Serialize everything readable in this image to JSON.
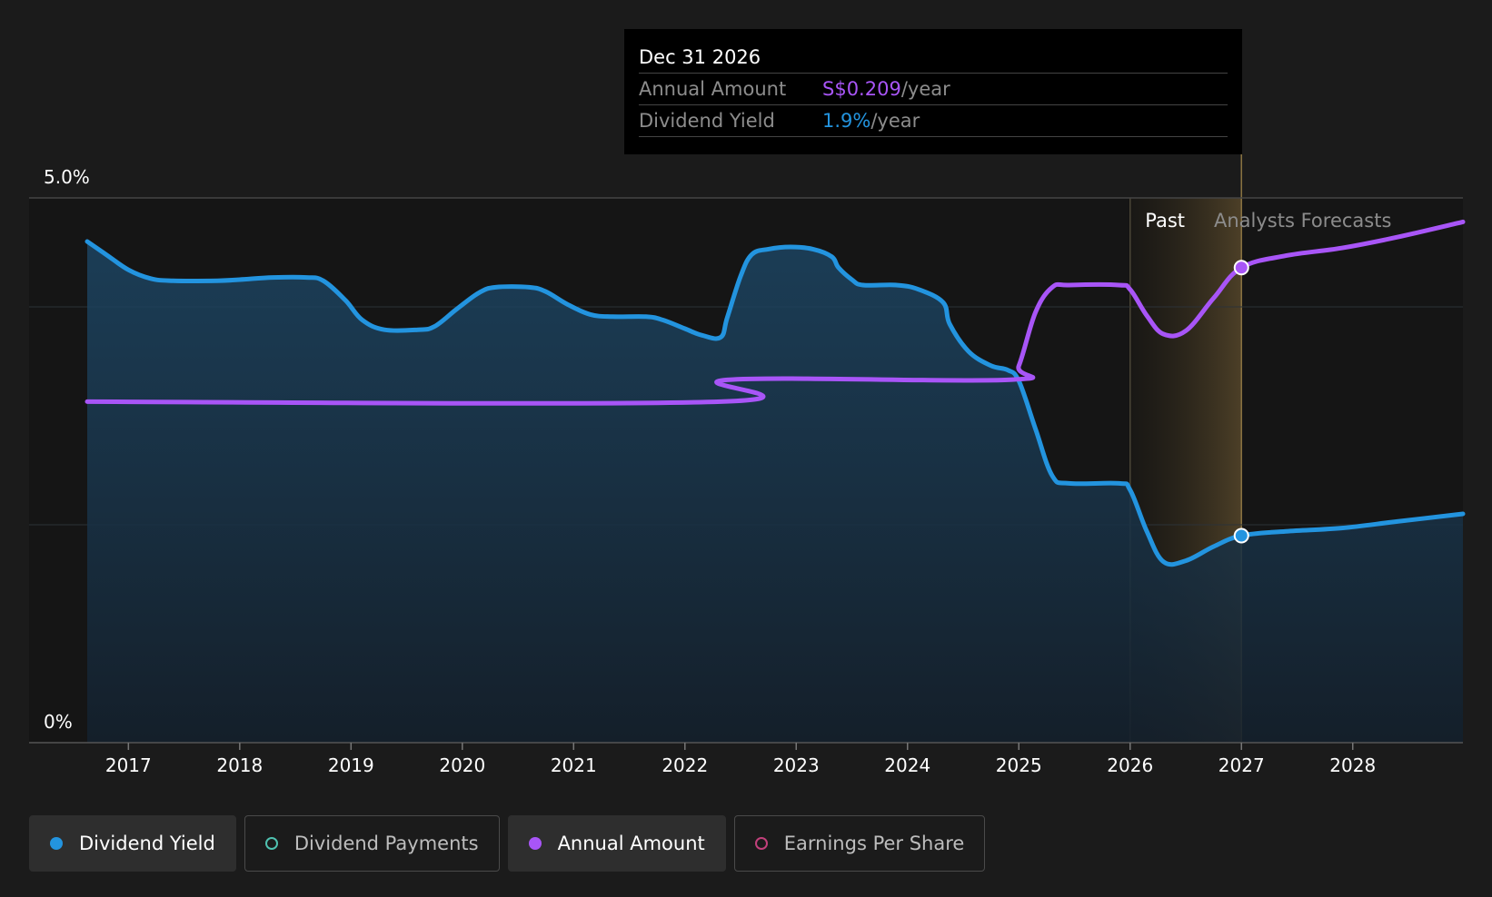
{
  "tooltip": {
    "date": "Dec 31 2026",
    "rows": [
      {
        "key": "Annual Amount",
        "value": "S$0.209",
        "unit": "/year"
      },
      {
        "key": "Dividend Yield",
        "value": "1.9%",
        "unit": "/year"
      }
    ]
  },
  "regions": {
    "past_label": "Past",
    "forecast_label": "Analysts Forecasts"
  },
  "legend": [
    {
      "label": "Dividend Yield",
      "active": true
    },
    {
      "label": "Dividend Payments",
      "active": false
    },
    {
      "label": "Annual Amount",
      "active": true
    },
    {
      "label": "Earnings Per Share",
      "active": false
    }
  ],
  "colors": {
    "dividend_yield": "#2394df",
    "annual_amount": "#a855f7",
    "dividend_payments": "#4fc1b0",
    "earnings_per_share": "#c2407b"
  },
  "chart_data": {
    "type": "line",
    "x_ticks": [
      "2017",
      "2018",
      "2019",
      "2020",
      "2021",
      "2022",
      "2023",
      "2024",
      "2025",
      "2026",
      "2027",
      "2028"
    ],
    "y_tick_labels": [
      "0%",
      "5.0%"
    ],
    "ylim": [
      0,
      5.0
    ],
    "xlim": [
      2016.63,
      2028.99
    ],
    "past_forecast_split": 2026.0,
    "highlight_range": [
      2026.0,
      2027.0
    ],
    "hover_x": 2027.0,
    "grid": true,
    "legend_position": "bottom",
    "series": [
      {
        "name": "Dividend Yield",
        "area": true,
        "points": [
          [
            2016.63,
            4.6
          ],
          [
            2016.8,
            4.48
          ],
          [
            2017.0,
            4.34
          ],
          [
            2017.2,
            4.26
          ],
          [
            2017.4,
            4.24
          ],
          [
            2017.8,
            4.24
          ],
          [
            2018.0,
            4.25
          ],
          [
            2018.3,
            4.27
          ],
          [
            2018.6,
            4.27
          ],
          [
            2018.75,
            4.24
          ],
          [
            2018.95,
            4.06
          ],
          [
            2019.1,
            3.88
          ],
          [
            2019.3,
            3.79
          ],
          [
            2019.6,
            3.79
          ],
          [
            2019.75,
            3.82
          ],
          [
            2019.95,
            3.98
          ],
          [
            2020.15,
            4.13
          ],
          [
            2020.3,
            4.18
          ],
          [
            2020.6,
            4.18
          ],
          [
            2020.75,
            4.14
          ],
          [
            2020.95,
            4.02
          ],
          [
            2021.15,
            3.93
          ],
          [
            2021.35,
            3.91
          ],
          [
            2021.65,
            3.91
          ],
          [
            2021.8,
            3.88
          ],
          [
            2022.0,
            3.8
          ],
          [
            2022.15,
            3.74
          ],
          [
            2022.32,
            3.72
          ],
          [
            2022.38,
            3.9
          ],
          [
            2022.5,
            4.28
          ],
          [
            2022.6,
            4.48
          ],
          [
            2022.75,
            4.53
          ],
          [
            2022.95,
            4.55
          ],
          [
            2023.15,
            4.53
          ],
          [
            2023.32,
            4.46
          ],
          [
            2023.38,
            4.36
          ],
          [
            2023.5,
            4.25
          ],
          [
            2023.6,
            4.2
          ],
          [
            2023.9,
            4.2
          ],
          [
            2024.1,
            4.16
          ],
          [
            2024.32,
            4.04
          ],
          [
            2024.38,
            3.84
          ],
          [
            2024.55,
            3.59
          ],
          [
            2024.75,
            3.46
          ],
          [
            2024.9,
            3.42
          ],
          [
            2025.0,
            3.32
          ],
          [
            2025.15,
            2.88
          ],
          [
            2025.3,
            2.45
          ],
          [
            2025.45,
            2.38
          ],
          [
            2025.9,
            2.38
          ],
          [
            2026.0,
            2.32
          ],
          [
            2026.15,
            1.94
          ],
          [
            2026.3,
            1.66
          ],
          [
            2026.5,
            1.67
          ],
          [
            2026.75,
            1.8
          ],
          [
            2027.0,
            1.9
          ],
          [
            2027.4,
            1.94
          ],
          [
            2027.9,
            1.97
          ],
          [
            2028.4,
            2.03
          ],
          [
            2028.99,
            2.1
          ]
        ]
      },
      {
        "name": "Annual Amount",
        "area": false,
        "points": [
          [
            2016.63,
            3.13
          ],
          [
            2022.32,
            3.13
          ],
          [
            2022.38,
            3.33
          ],
          [
            2024.9,
            3.33
          ],
          [
            2025.0,
            3.46
          ],
          [
            2025.15,
            3.95
          ],
          [
            2025.3,
            4.18
          ],
          [
            2025.45,
            4.2
          ],
          [
            2025.9,
            4.2
          ],
          [
            2026.0,
            4.16
          ],
          [
            2026.15,
            3.92
          ],
          [
            2026.3,
            3.75
          ],
          [
            2026.5,
            3.78
          ],
          [
            2026.75,
            4.08
          ],
          [
            2027.0,
            4.36
          ],
          [
            2027.4,
            4.47
          ],
          [
            2027.9,
            4.54
          ],
          [
            2028.4,
            4.64
          ],
          [
            2028.99,
            4.78
          ]
        ]
      }
    ]
  }
}
